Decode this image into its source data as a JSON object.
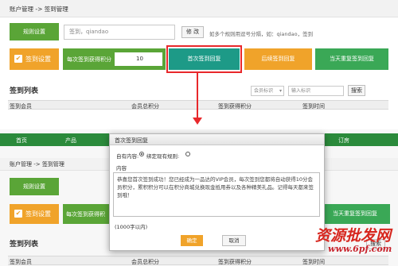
{
  "top": {
    "breadcrumb": "账户管理 -> 签到管理",
    "rule_btn": "规则设置",
    "keyword_input": "签到，qiandao",
    "modify_btn": "修 改",
    "hint": "如多个规则用逗号分隔，如：qiandao，签到",
    "signin_settings": "签到设置",
    "points_label": "每次签到获得积分",
    "points_value": "10",
    "btn_first": "首次签到回复",
    "btn_later": "后续签到回复",
    "btn_repeat": "当天重复签到回复",
    "list_title": "签到列表",
    "member_select": "会员标识",
    "search_input": "输入标识",
    "search_btn": "搜索",
    "headers": [
      "签到会员",
      "会员总积分",
      "签到获得积分",
      "签到时间"
    ]
  },
  "bottom": {
    "nav": [
      "首页",
      "产品",
      "订房"
    ],
    "breadcrumb": "账户管理 -> 签到管理",
    "rule_btn": "规则设置",
    "signin_settings": "签到设置",
    "points_label": "每次签到获得积",
    "btn_repeat": "当天重复签到回复",
    "list_title": "签到列表",
    "search_btn": "搜索",
    "headers": [
      "签到会员",
      "会员总积分",
      "签到获得积分",
      "签到时间"
    ]
  },
  "modal": {
    "title": "首次签到回复",
    "content_type_label": "自有内容:",
    "option_label": "绑定现有规则:",
    "content_label": "内容",
    "text": "恭喜您首次签到成功！您已经成为一品达的VIP会员，每次签到您都将自动获得10分会员积分，累积积分可以在积分商城兑换现金抵用券以及各种精美礼品。记得每天都来签到哦！",
    "limit": "(1000字以内)",
    "confirm": "确定",
    "cancel": "取消"
  },
  "watermark": {
    "cn": "资源批发网",
    "url": "www.6pf.com"
  },
  "colors": {
    "green": "#5aa537",
    "orange": "#f0a32a",
    "teal": "#1d9a87",
    "highlight": "#e8282b"
  }
}
